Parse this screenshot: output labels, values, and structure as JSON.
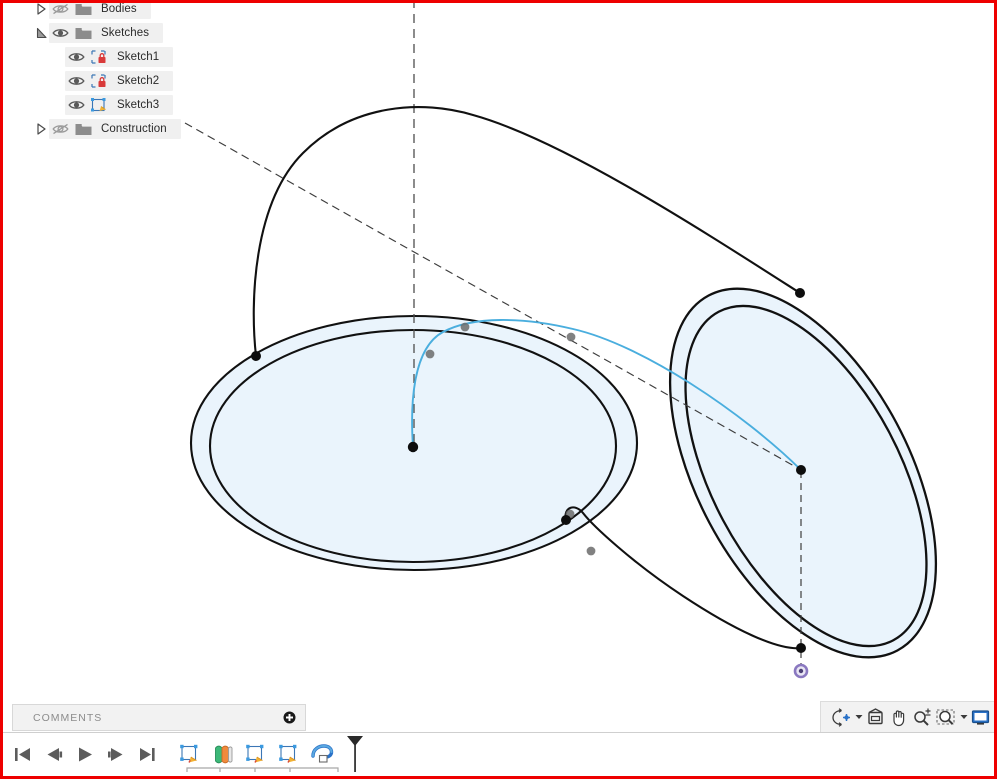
{
  "app": {
    "accent_red": "#ee0000",
    "sketch_fill": "#eaf4fc",
    "sketch_line": "#1a1a1a",
    "spline_color": "#4aaede",
    "construction_color": "#5a5a5a",
    "origin_color": "#8a78c0",
    "panel_bg": "#f2f2f2"
  },
  "browser": {
    "items": [
      {
        "label": "Bodies",
        "icon": "folder-icon",
        "eye": "eye-hidden-icon",
        "arrow": "triangle-collapsed-icon",
        "indent": 0
      },
      {
        "label": "Sketches",
        "icon": "folder-icon",
        "eye": "eye-visible-icon",
        "arrow": "triangle-expanded-icon",
        "indent": 0
      },
      {
        "label": "Sketch1",
        "icon": "sketch-locked-icon",
        "eye": "eye-visible-icon",
        "arrow": "none",
        "indent": 1
      },
      {
        "label": "Sketch2",
        "icon": "sketch-locked-icon",
        "eye": "eye-visible-icon",
        "arrow": "none",
        "indent": 1
      },
      {
        "label": "Sketch3",
        "icon": "sketch-editing-icon",
        "eye": "eye-visible-icon",
        "arrow": "none",
        "indent": 1
      },
      {
        "label": "Construction",
        "icon": "folder-icon",
        "eye": "eye-hidden-icon",
        "arrow": "triangle-collapsed-icon",
        "indent": 0
      }
    ]
  },
  "comments": {
    "title": "COMMENTS",
    "add_icon": "plus-circle-icon"
  },
  "nav_bar": {
    "buttons": [
      {
        "name": "orbit-button",
        "icon": "orbit-icon",
        "has_caret": true
      },
      {
        "name": "look-at-button",
        "icon": "look-at-icon",
        "has_caret": false
      },
      {
        "name": "pan-button",
        "icon": "pan-hand-icon",
        "has_caret": false
      },
      {
        "name": "zoom-button",
        "icon": "zoom-icon",
        "has_caret": false
      },
      {
        "name": "zoom-window-button",
        "icon": "zoom-window-icon",
        "has_caret": true
      },
      {
        "name": "display-settings-button",
        "icon": "display-settings-icon",
        "has_caret": false
      }
    ]
  },
  "timeline": {
    "playback": [
      {
        "name": "skip-to-start-button",
        "icon": "skip-start-icon"
      },
      {
        "name": "step-back-button",
        "icon": "step-back-icon"
      },
      {
        "name": "play-button",
        "icon": "play-icon"
      },
      {
        "name": "step-forward-button",
        "icon": "step-forward-icon"
      },
      {
        "name": "skip-to-end-button",
        "icon": "skip-end-icon"
      }
    ],
    "features": [
      {
        "name": "timeline-sketch1",
        "icon": "sketch-feature-icon"
      },
      {
        "name": "timeline-loft",
        "icon": "loft-feature-icon"
      },
      {
        "name": "timeline-sketch2",
        "icon": "sketch-feature-icon"
      },
      {
        "name": "timeline-sketch3",
        "icon": "sketch-feature-icon"
      },
      {
        "name": "timeline-sweep",
        "icon": "sweep-feature-icon"
      }
    ],
    "playhead_icon": "playhead-marker-icon"
  },
  "canvas": {
    "left_profile_label": "left-ellipse-profile",
    "right_profile_label": "right-ellipse-profile",
    "spline_label": "construction-spline",
    "loft_rail_top_label": "loft-rail-top",
    "loft_rail_bottom_label": "loft-rail-bottom",
    "origin_point_label": "origin-point"
  }
}
